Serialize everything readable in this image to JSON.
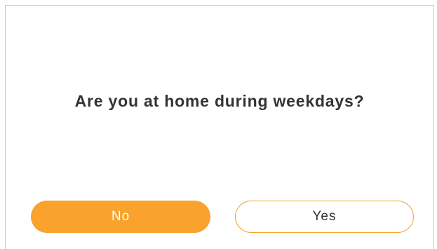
{
  "dialog": {
    "question": "Are you at home during weekdays?",
    "no_label": "No",
    "yes_label": "Yes"
  },
  "colors": {
    "accent": "#f9a22c",
    "text": "#333333",
    "border": "#c4c4c4"
  }
}
